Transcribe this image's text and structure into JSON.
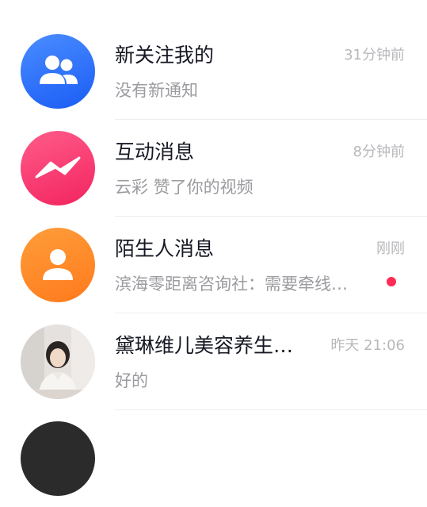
{
  "colors": {
    "new_follower_avatar": "#2f6cff",
    "interaction_avatar": "#f73a6e",
    "stranger_avatar": "#ff8a2a",
    "unread_dot": "#fe2c55",
    "title_text": "#161823",
    "secondary_text": "#9b9ba0"
  },
  "messages": [
    {
      "icon": "users-icon",
      "title": "新关注我的",
      "subtitle": "没有新通知",
      "time": "31分钟前",
      "unread": false
    },
    {
      "icon": "lightning-message-icon",
      "title": "互动消息",
      "subtitle": "云彩 赞了你的视频",
      "time": "8分钟前",
      "unread": false
    },
    {
      "icon": "person-icon",
      "title": "陌生人消息",
      "subtitle": "滨海零距离咨询社：需要牵线…",
      "time": "刚刚",
      "unread": true
    },
    {
      "icon": "user-photo-avatar",
      "title": "黛琳维儿美容养生…",
      "subtitle": "好的",
      "time": "昨天 21:06",
      "unread": false
    }
  ]
}
